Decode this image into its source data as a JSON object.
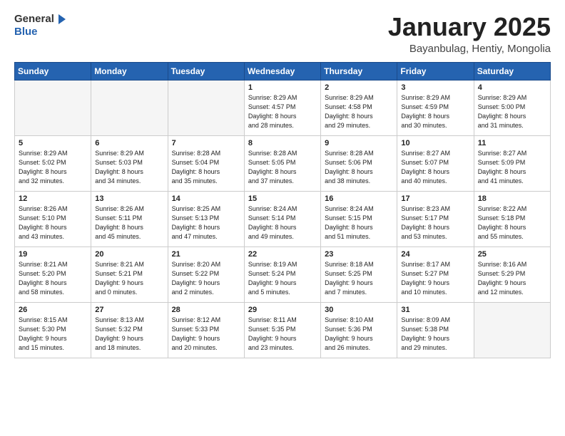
{
  "header": {
    "logo_general": "General",
    "logo_blue": "Blue",
    "month_title": "January 2025",
    "location": "Bayanbulag, Hentiy, Mongolia"
  },
  "weekdays": [
    "Sunday",
    "Monday",
    "Tuesday",
    "Wednesday",
    "Thursday",
    "Friday",
    "Saturday"
  ],
  "weeks": [
    [
      {
        "day": "",
        "info": ""
      },
      {
        "day": "",
        "info": ""
      },
      {
        "day": "",
        "info": ""
      },
      {
        "day": "1",
        "info": "Sunrise: 8:29 AM\nSunset: 4:57 PM\nDaylight: 8 hours\nand 28 minutes."
      },
      {
        "day": "2",
        "info": "Sunrise: 8:29 AM\nSunset: 4:58 PM\nDaylight: 8 hours\nand 29 minutes."
      },
      {
        "day": "3",
        "info": "Sunrise: 8:29 AM\nSunset: 4:59 PM\nDaylight: 8 hours\nand 30 minutes."
      },
      {
        "day": "4",
        "info": "Sunrise: 8:29 AM\nSunset: 5:00 PM\nDaylight: 8 hours\nand 31 minutes."
      }
    ],
    [
      {
        "day": "5",
        "info": "Sunrise: 8:29 AM\nSunset: 5:02 PM\nDaylight: 8 hours\nand 32 minutes."
      },
      {
        "day": "6",
        "info": "Sunrise: 8:29 AM\nSunset: 5:03 PM\nDaylight: 8 hours\nand 34 minutes."
      },
      {
        "day": "7",
        "info": "Sunrise: 8:28 AM\nSunset: 5:04 PM\nDaylight: 8 hours\nand 35 minutes."
      },
      {
        "day": "8",
        "info": "Sunrise: 8:28 AM\nSunset: 5:05 PM\nDaylight: 8 hours\nand 37 minutes."
      },
      {
        "day": "9",
        "info": "Sunrise: 8:28 AM\nSunset: 5:06 PM\nDaylight: 8 hours\nand 38 minutes."
      },
      {
        "day": "10",
        "info": "Sunrise: 8:27 AM\nSunset: 5:07 PM\nDaylight: 8 hours\nand 40 minutes."
      },
      {
        "day": "11",
        "info": "Sunrise: 8:27 AM\nSunset: 5:09 PM\nDaylight: 8 hours\nand 41 minutes."
      }
    ],
    [
      {
        "day": "12",
        "info": "Sunrise: 8:26 AM\nSunset: 5:10 PM\nDaylight: 8 hours\nand 43 minutes."
      },
      {
        "day": "13",
        "info": "Sunrise: 8:26 AM\nSunset: 5:11 PM\nDaylight: 8 hours\nand 45 minutes."
      },
      {
        "day": "14",
        "info": "Sunrise: 8:25 AM\nSunset: 5:13 PM\nDaylight: 8 hours\nand 47 minutes."
      },
      {
        "day": "15",
        "info": "Sunrise: 8:24 AM\nSunset: 5:14 PM\nDaylight: 8 hours\nand 49 minutes."
      },
      {
        "day": "16",
        "info": "Sunrise: 8:24 AM\nSunset: 5:15 PM\nDaylight: 8 hours\nand 51 minutes."
      },
      {
        "day": "17",
        "info": "Sunrise: 8:23 AM\nSunset: 5:17 PM\nDaylight: 8 hours\nand 53 minutes."
      },
      {
        "day": "18",
        "info": "Sunrise: 8:22 AM\nSunset: 5:18 PM\nDaylight: 8 hours\nand 55 minutes."
      }
    ],
    [
      {
        "day": "19",
        "info": "Sunrise: 8:21 AM\nSunset: 5:20 PM\nDaylight: 8 hours\nand 58 minutes."
      },
      {
        "day": "20",
        "info": "Sunrise: 8:21 AM\nSunset: 5:21 PM\nDaylight: 9 hours\nand 0 minutes."
      },
      {
        "day": "21",
        "info": "Sunrise: 8:20 AM\nSunset: 5:22 PM\nDaylight: 9 hours\nand 2 minutes."
      },
      {
        "day": "22",
        "info": "Sunrise: 8:19 AM\nSunset: 5:24 PM\nDaylight: 9 hours\nand 5 minutes."
      },
      {
        "day": "23",
        "info": "Sunrise: 8:18 AM\nSunset: 5:25 PM\nDaylight: 9 hours\nand 7 minutes."
      },
      {
        "day": "24",
        "info": "Sunrise: 8:17 AM\nSunset: 5:27 PM\nDaylight: 9 hours\nand 10 minutes."
      },
      {
        "day": "25",
        "info": "Sunrise: 8:16 AM\nSunset: 5:29 PM\nDaylight: 9 hours\nand 12 minutes."
      }
    ],
    [
      {
        "day": "26",
        "info": "Sunrise: 8:15 AM\nSunset: 5:30 PM\nDaylight: 9 hours\nand 15 minutes."
      },
      {
        "day": "27",
        "info": "Sunrise: 8:13 AM\nSunset: 5:32 PM\nDaylight: 9 hours\nand 18 minutes."
      },
      {
        "day": "28",
        "info": "Sunrise: 8:12 AM\nSunset: 5:33 PM\nDaylight: 9 hours\nand 20 minutes."
      },
      {
        "day": "29",
        "info": "Sunrise: 8:11 AM\nSunset: 5:35 PM\nDaylight: 9 hours\nand 23 minutes."
      },
      {
        "day": "30",
        "info": "Sunrise: 8:10 AM\nSunset: 5:36 PM\nDaylight: 9 hours\nand 26 minutes."
      },
      {
        "day": "31",
        "info": "Sunrise: 8:09 AM\nSunset: 5:38 PM\nDaylight: 9 hours\nand 29 minutes."
      },
      {
        "day": "",
        "info": ""
      }
    ]
  ]
}
